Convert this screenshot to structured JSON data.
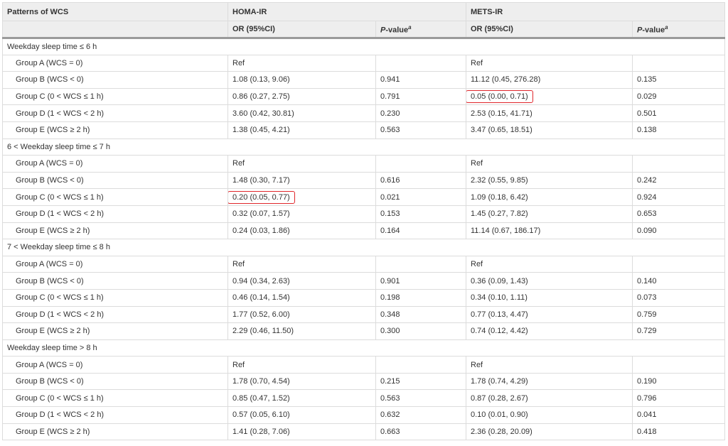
{
  "table": {
    "headers": {
      "patterns": "Patterns of WCS",
      "homa": "HOMA-IR",
      "mets": "METS-IR",
      "or": "OR (95%CI)",
      "p_label": "P",
      "p_suffix": "-value",
      "p_sup": "a"
    },
    "sections": [
      {
        "title": "Weekday sleep time ≤ 6 h",
        "rows": [
          {
            "group": "Group A (WCS = 0)",
            "homa_or": "Ref",
            "homa_p": "",
            "mets_or": "Ref",
            "mets_p": ""
          },
          {
            "group": "Group B (WCS < 0)",
            "homa_or": "1.08 (0.13, 9.06)",
            "homa_p": "0.941",
            "mets_or": "11.12 (0.45, 276.28)",
            "mets_p": "0.135"
          },
          {
            "group": "Group C (0 < WCS ≤ 1 h)",
            "homa_or": "0.86 (0.27, 2.75)",
            "homa_p": "0.791",
            "mets_or": "0.05 (0.00, 0.71)",
            "mets_p": "0.029",
            "highlight": "mets"
          },
          {
            "group": "Group D (1 < WCS < 2 h)",
            "homa_or": "3.60 (0.42, 30.81)",
            "homa_p": "0.230",
            "mets_or": "2.53 (0.15, 41.71)",
            "mets_p": "0.501"
          },
          {
            "group": "Group E (WCS ≥ 2 h)",
            "homa_or": "1.38 (0.45, 4.21)",
            "homa_p": "0.563",
            "mets_or": "3.47 (0.65, 18.51)",
            "mets_p": "0.138"
          }
        ]
      },
      {
        "title": "6 < Weekday sleep time ≤ 7 h",
        "rows": [
          {
            "group": "Group A (WCS = 0)",
            "homa_or": "Ref",
            "homa_p": "",
            "mets_or": "Ref",
            "mets_p": ""
          },
          {
            "group": "Group B (WCS < 0)",
            "homa_or": "1.48 (0.30, 7.17)",
            "homa_p": "0.616",
            "mets_or": "2.32 (0.55, 9.85)",
            "mets_p": "0.242"
          },
          {
            "group": "Group C (0 < WCS ≤ 1 h)",
            "homa_or": "0.20 (0.05, 0.77)",
            "homa_p": "0.021",
            "mets_or": "1.09 (0.18, 6.42)",
            "mets_p": "0.924",
            "highlight": "homa"
          },
          {
            "group": "Group D (1 < WCS < 2 h)",
            "homa_or": "0.32 (0.07, 1.57)",
            "homa_p": "0.153",
            "mets_or": "1.45 (0.27, 7.82)",
            "mets_p": "0.653"
          },
          {
            "group": "Group E (WCS ≥ 2 h)",
            "homa_or": "0.24 (0.03, 1.86)",
            "homa_p": "0.164",
            "mets_or": "11.14 (0.67, 186.17)",
            "mets_p": "0.090"
          }
        ]
      },
      {
        "title": "7 < Weekday sleep time ≤ 8 h",
        "rows": [
          {
            "group": "Group A (WCS = 0)",
            "homa_or": "Ref",
            "homa_p": "",
            "mets_or": "Ref",
            "mets_p": ""
          },
          {
            "group": "Group B (WCS < 0)",
            "homa_or": "0.94 (0.34, 2.63)",
            "homa_p": "0.901",
            "mets_or": "0.36 (0.09, 1.43)",
            "mets_p": "0.140"
          },
          {
            "group": "Group C (0 < WCS ≤ 1 h)",
            "homa_or": "0.46 (0.14, 1.54)",
            "homa_p": "0.198",
            "mets_or": "0.34 (0.10, 1.11)",
            "mets_p": "0.073"
          },
          {
            "group": "Group D (1 < WCS < 2 h)",
            "homa_or": "1.77 (0.52, 6.00)",
            "homa_p": "0.348",
            "mets_or": "0.77 (0.13, 4.47)",
            "mets_p": "0.759"
          },
          {
            "group": "Group E (WCS ≥ 2 h)",
            "homa_or": "2.29 (0.46, 11.50)",
            "homa_p": "0.300",
            "mets_or": "0.74 (0.12, 4.42)",
            "mets_p": "0.729"
          }
        ]
      },
      {
        "title": "Weekday sleep time > 8 h",
        "rows": [
          {
            "group": "Group A (WCS = 0)",
            "homa_or": "Ref",
            "homa_p": "",
            "mets_or": "Ref",
            "mets_p": ""
          },
          {
            "group": "Group B (WCS < 0)",
            "homa_or": "1.78 (0.70, 4.54)",
            "homa_p": "0.215",
            "mets_or": "1.78 (0.74, 4.29)",
            "mets_p": "0.190"
          },
          {
            "group": "Group C (0 < WCS ≤ 1 h)",
            "homa_or": "0.85 (0.47, 1.52)",
            "homa_p": "0.563",
            "mets_or": "0.87 (0.28, 2.67)",
            "mets_p": "0.796"
          },
          {
            "group": "Group D (1 < WCS < 2 h)",
            "homa_or": "0.57 (0.05, 6.10)",
            "homa_p": "0.632",
            "mets_or": "0.10 (0.01, 0.90)",
            "mets_p": "0.041"
          },
          {
            "group": "Group E (WCS ≥ 2 h)",
            "homa_or": "1.41 (0.28, 7.06)",
            "homa_p": "0.663",
            "mets_or": "2.36 (0.28, 20.09)",
            "mets_p": "0.418"
          }
        ]
      }
    ],
    "colors": {
      "highlight_border": "#e0262b",
      "header_bg": "#eeeeee"
    }
  }
}
